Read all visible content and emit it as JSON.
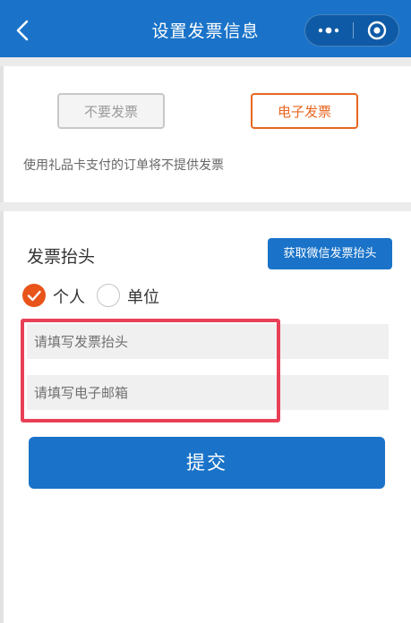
{
  "nav": {
    "title": "设置发票信息",
    "back_icon": "chevron-left-icon",
    "more_icon": "more-dots-icon",
    "close_icon": "target-circle-icon",
    "color": "#1a73c8"
  },
  "invoice_type": {
    "no_invoice_label": "不要发票",
    "e_invoice_label": "电子发票",
    "selected": "电子发票",
    "accent_color": "#e8661f"
  },
  "note": "使用礼品卡支付的订单将不提供发票",
  "header_section": {
    "title": "发票抬头",
    "wechat_button": "获取微信发票抬头",
    "options": [
      {
        "label": "个人",
        "selected": true
      },
      {
        "label": "单位",
        "selected": false
      }
    ]
  },
  "form": {
    "title_placeholder": "请填写发票抬头",
    "email_placeholder": "请填写电子邮箱",
    "highlight_color": "#e84057"
  },
  "submit_label": "提交"
}
